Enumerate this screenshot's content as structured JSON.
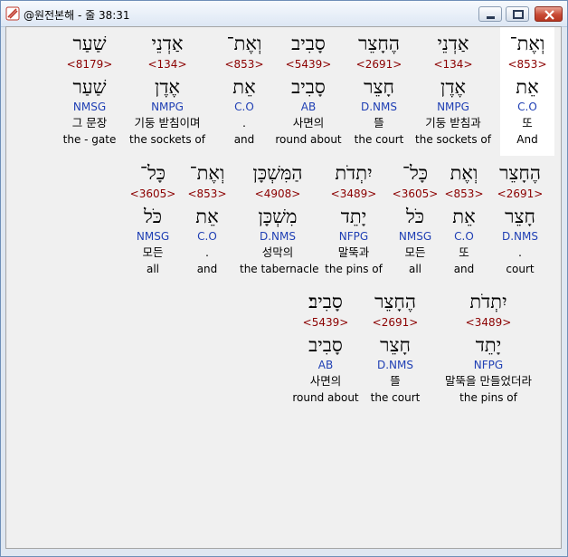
{
  "window": {
    "title": "@원전본해 - 줄 38:31"
  },
  "rows": [
    [
      {
        "heb": "שַׁעַר",
        "strong": "<8179>",
        "lemma": "שַׁעַר",
        "morph": "NMSG",
        "kor": "그 문장",
        "eng": "the - gate"
      },
      {
        "heb": "אַדְנֵי",
        "strong": "<134>",
        "lemma": "אֶדֶן",
        "morph": "NMPG",
        "kor": "기둥 받침이며",
        "eng": "the sockets of"
      },
      {
        "heb": "וְאֶת־",
        "strong": "<853>",
        "lemma": "אֵת",
        "morph": "C.O",
        "kor": ".",
        "eng": "and"
      },
      {
        "heb": "סָבִיב",
        "strong": "<5439>",
        "lemma": "סָבִיב",
        "morph": "AB",
        "kor": "사면의",
        "eng": "round about"
      },
      {
        "heb": "הֶחָצֵר",
        "strong": "<2691>",
        "lemma": "חָצֵר",
        "morph": "D.NMS",
        "kor": "뜰",
        "eng": "the court"
      },
      {
        "heb": "אַדְנֵי",
        "strong": "<134>",
        "lemma": "אֶדֶן",
        "morph": "NMPG",
        "kor": "기둥 받침과",
        "eng": "the sockets of"
      },
      {
        "heb": "וְאֶת־",
        "strong": "<853>",
        "lemma": "אֵת",
        "morph": "C.O",
        "kor": "또",
        "eng": "And"
      }
    ],
    [
      {
        "heb": "כָּל־",
        "strong": "<3605>",
        "lemma": "כֹּל",
        "morph": "NMSG",
        "kor": "모든",
        "eng": "all"
      },
      {
        "heb": "וְאֶת־",
        "strong": "<853>",
        "lemma": "אֵת",
        "morph": "C.O",
        "kor": ".",
        "eng": "and"
      },
      {
        "heb": "הַמִּשְׁכָּן",
        "strong": "<4908>",
        "lemma": "מִשְׁכָּן",
        "morph": "D.NMS",
        "kor": "성막의",
        "eng": "the tabernacle"
      },
      {
        "heb": "יִתְדֹת",
        "strong": "<3489>",
        "lemma": "יָתֵד",
        "morph": "NFPG",
        "kor": "말뚝과",
        "eng": "the pins of"
      },
      {
        "heb": "כָּל־",
        "strong": "<3605>",
        "lemma": "כֹּל",
        "morph": "NMSG",
        "kor": "모든",
        "eng": "all"
      },
      {
        "heb": "וְאֶת",
        "strong": "<853>",
        "lemma": "אֵת",
        "morph": "C.O",
        "kor": "또",
        "eng": "and"
      },
      {
        "heb": "הֶחָצֵר",
        "strong": "<2691>",
        "lemma": "חָצֵר",
        "morph": "D.NMS",
        "kor": ".",
        "eng": "court"
      }
    ],
    [
      {
        "heb": "סָבִיב׃",
        "strong": "<5439>",
        "lemma": "סָבִיב",
        "morph": "AB",
        "kor": "사면의",
        "eng": "round about"
      },
      {
        "heb": "הֶחָצֵר",
        "strong": "<2691>",
        "lemma": "חָצֵר",
        "morph": "D.NMS",
        "kor": "뜰",
        "eng": "the court"
      },
      {
        "heb": "יִתְדֹת",
        "strong": "<3489>",
        "lemma": "יָתֵד",
        "morph": "NFPG",
        "kor": "말뚝을 만들었더라",
        "eng": "the pins of"
      }
    ]
  ]
}
